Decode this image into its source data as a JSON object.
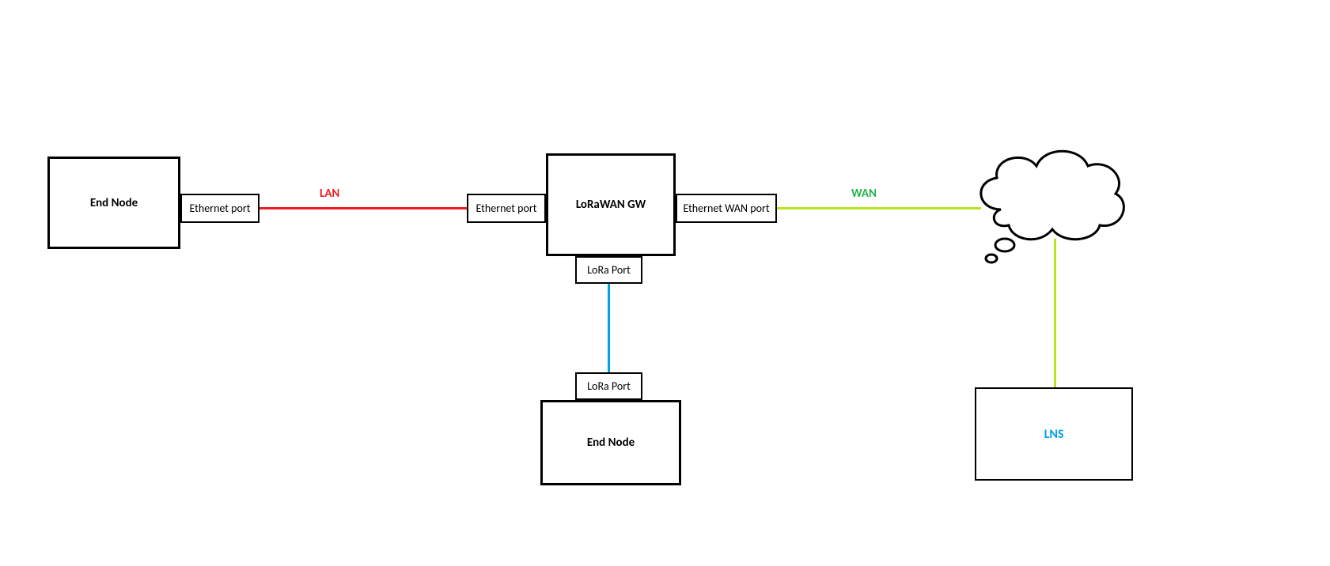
{
  "nodes": {
    "end_node_left": "End Node",
    "end_node_bottom": "End Node",
    "gateway": "LoRaWAN GW",
    "lns": "LNS"
  },
  "ports": {
    "eth_left_node": "Ethernet port",
    "eth_gw_left": "Ethernet port",
    "eth_wan": "Ethernet WAN port",
    "lora_gw": "LoRa Port",
    "lora_node": "LoRa Port"
  },
  "labels": {
    "lan": "LAN",
    "wan": "WAN"
  }
}
